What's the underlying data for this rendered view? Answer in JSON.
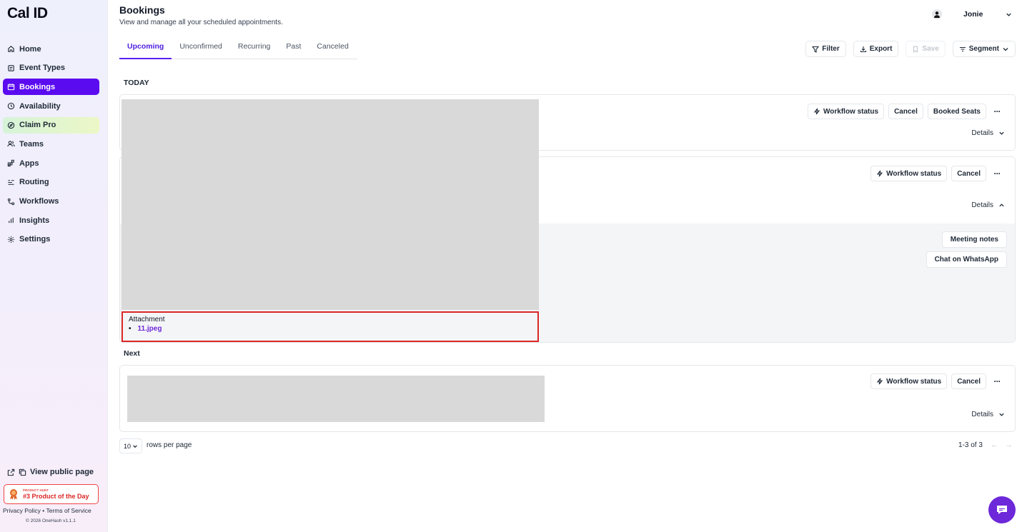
{
  "app": {
    "logo": "Cal ID"
  },
  "sidebar": {
    "items": [
      {
        "label": "Home",
        "icon": "home-icon"
      },
      {
        "label": "Event Types",
        "icon": "event-types-icon"
      },
      {
        "label": "Bookings",
        "icon": "calendar-icon"
      },
      {
        "label": "Availability",
        "icon": "clock-icon"
      },
      {
        "label": "Claim Pro",
        "icon": "compass-icon"
      },
      {
        "label": "Teams",
        "icon": "users-icon"
      },
      {
        "label": "Apps",
        "icon": "grid-icon"
      },
      {
        "label": "Routing",
        "icon": "routing-icon"
      },
      {
        "label": "Workflows",
        "icon": "workflow-icon"
      },
      {
        "label": "Insights",
        "icon": "bar-chart-icon"
      },
      {
        "label": "Settings",
        "icon": "gear-icon"
      }
    ],
    "active": "Bookings",
    "public_page": "View public page",
    "product_hunt": {
      "small": "PRODUCT HUNT",
      "big": "#3 Product of the Day"
    },
    "footer": {
      "privacy": "Privacy Policy",
      "sep": "•",
      "terms": "Terms of Service",
      "copyright": "© 2026 OneHash v1.1.1"
    }
  },
  "header": {
    "title": "Bookings",
    "subtitle": "View and manage all your scheduled appointments.",
    "user_name": "Jonie"
  },
  "tabs": [
    "Upcoming",
    "Unconfirmed",
    "Recurring",
    "Past",
    "Canceled"
  ],
  "active_tab": "Upcoming",
  "toolbar": {
    "filter": "Filter",
    "export": "Export",
    "save": "Save",
    "segment": "Segment"
  },
  "sections": {
    "today": "TODAY",
    "next": "Next"
  },
  "bookings": {
    "card1": {
      "workflow": "Workflow status",
      "cancel": "Cancel",
      "seats": "Booked Seats",
      "details": "Details"
    },
    "card2": {
      "workflow": "Workflow status",
      "cancel": "Cancel",
      "details": "Details",
      "meeting_notes": "Meeting notes",
      "whatsapp": "Chat on WhatsApp",
      "attachment_title": "Attachment",
      "attachment_file": "11.jpeg"
    },
    "card3": {
      "workflow": "Workflow status",
      "cancel": "Cancel",
      "details": "Details"
    }
  },
  "pagination": {
    "rows": "10",
    "rows_label": "rows per page",
    "info": "1-3 of 3"
  },
  "colors": {
    "accent": "#5b0bf0",
    "highlight": "#dc2626",
    "link": "#6d28d9"
  }
}
